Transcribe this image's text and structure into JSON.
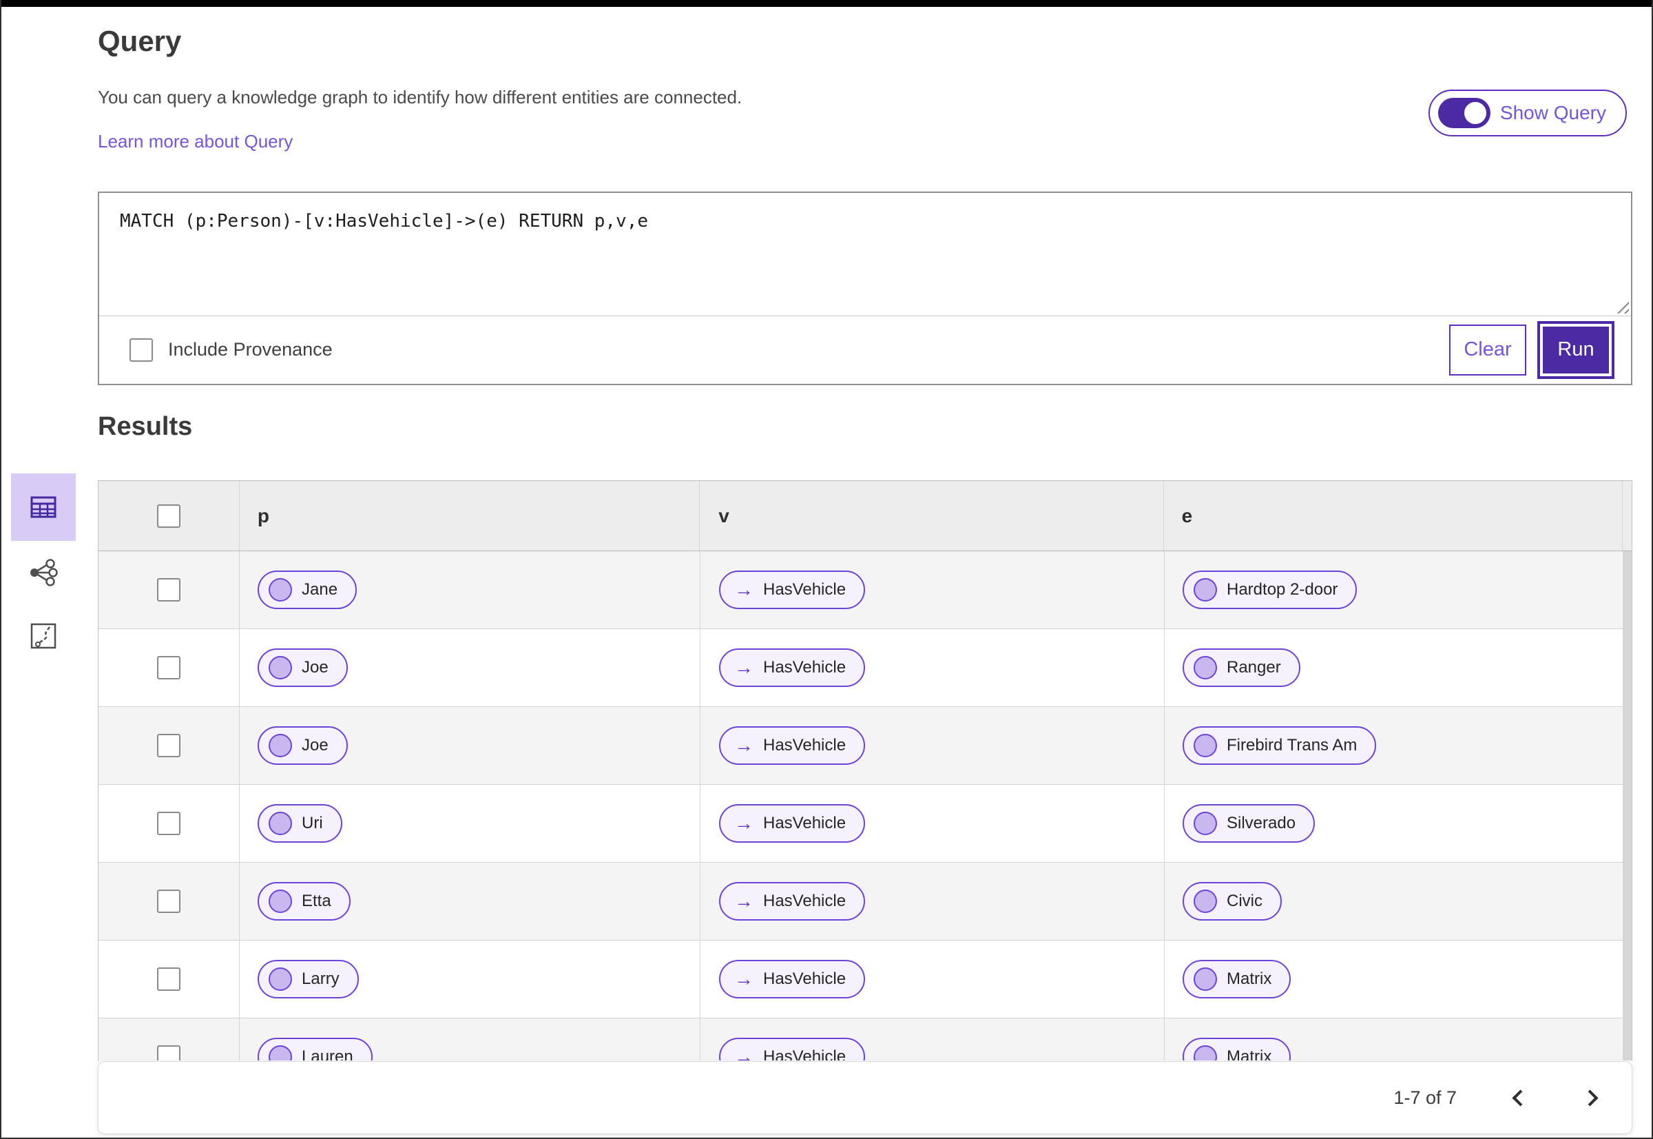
{
  "header": {
    "title": "Query",
    "description": "You can query a knowledge graph to identify how different entities are connected.",
    "learn_more_link": "Learn more about Query",
    "show_query_label": "Show Query",
    "show_query_toggle_on": true
  },
  "query_editor": {
    "query_text": "MATCH (p:Person)-[v:HasVehicle]->(e) RETURN p,v,e",
    "include_provenance_label": "Include Provenance",
    "include_provenance_checked": false,
    "clear_label": "Clear",
    "run_label": "Run"
  },
  "results": {
    "heading": "Results",
    "columns": [
      "p",
      "v",
      "e"
    ],
    "rows": [
      {
        "p": "Jane",
        "v": "HasVehicle",
        "e": "Hardtop 2-door"
      },
      {
        "p": "Joe",
        "v": "HasVehicle",
        "e": "Ranger"
      },
      {
        "p": "Joe",
        "v": "HasVehicle",
        "e": "Firebird Trans Am"
      },
      {
        "p": "Uri",
        "v": "HasVehicle",
        "e": "Silverado"
      },
      {
        "p": "Etta",
        "v": "HasVehicle",
        "e": "Civic"
      },
      {
        "p": "Larry",
        "v": "HasVehicle",
        "e": "Matrix"
      },
      {
        "p": "Lauren",
        "v": "HasVehicle",
        "e": "Matrix"
      }
    ],
    "pagination": {
      "range_label": "1-7 of 7"
    }
  },
  "sidebar": {
    "views": [
      {
        "label": "table-view",
        "icon": "table-icon",
        "active": true
      },
      {
        "label": "graph-view",
        "icon": "graph-network-icon",
        "active": false
      },
      {
        "label": "chart-view",
        "icon": "map-route-icon",
        "active": false
      }
    ]
  },
  "icons": {
    "arrow_right": "→"
  },
  "colors": {
    "primary_purple": "#4b2aa3",
    "pill_border_purple": "#6d44d8",
    "pill_background": "#f5f2fd",
    "pill_circle_fill": "#c9b8f0",
    "link_purple": "#7456d9",
    "active_tile_background": "#d8ccf6",
    "table_header_background": "#ededed",
    "row_alternate_background": "#f4f4f4",
    "topbar_black": "#000000"
  }
}
